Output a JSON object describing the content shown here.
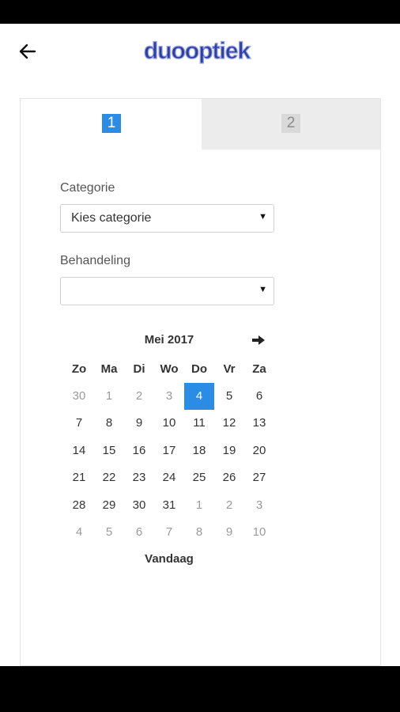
{
  "header": {
    "back_icon": "arrow-left-icon",
    "logo_text": "duooptiek",
    "colors": {
      "logo_fill": "#2f3f9e",
      "accent": "#2b8ce6"
    }
  },
  "steps": [
    {
      "label": "1",
      "active": true
    },
    {
      "label": "2",
      "active": false
    }
  ],
  "form": {
    "category_label": "Categorie",
    "category_value": "Kies categorie",
    "treatment_label": "Behandeling",
    "treatment_value": ""
  },
  "calendar": {
    "month_label": "Mei 2017",
    "next_icon": "arrow-right-icon",
    "weekdays": [
      "Zo",
      "Ma",
      "Di",
      "Wo",
      "Do",
      "Vr",
      "Za"
    ],
    "weeks": [
      [
        {
          "d": "30",
          "m": true
        },
        {
          "d": "1",
          "m": true
        },
        {
          "d": "2",
          "m": true
        },
        {
          "d": "3",
          "m": true
        },
        {
          "d": "4",
          "s": true
        },
        {
          "d": "5"
        },
        {
          "d": "6"
        }
      ],
      [
        {
          "d": "7"
        },
        {
          "d": "8"
        },
        {
          "d": "9"
        },
        {
          "d": "10"
        },
        {
          "d": "11"
        },
        {
          "d": "12"
        },
        {
          "d": "13"
        }
      ],
      [
        {
          "d": "14"
        },
        {
          "d": "15"
        },
        {
          "d": "16"
        },
        {
          "d": "17"
        },
        {
          "d": "18"
        },
        {
          "d": "19"
        },
        {
          "d": "20"
        }
      ],
      [
        {
          "d": "21"
        },
        {
          "d": "22"
        },
        {
          "d": "23"
        },
        {
          "d": "24"
        },
        {
          "d": "25"
        },
        {
          "d": "26"
        },
        {
          "d": "27"
        }
      ],
      [
        {
          "d": "28"
        },
        {
          "d": "29"
        },
        {
          "d": "30"
        },
        {
          "d": "31"
        },
        {
          "d": "1",
          "m": true
        },
        {
          "d": "2",
          "m": true
        },
        {
          "d": "3",
          "m": true
        }
      ],
      [
        {
          "d": "4",
          "m": true
        },
        {
          "d": "5",
          "m": true
        },
        {
          "d": "6",
          "m": true
        },
        {
          "d": "7",
          "m": true
        },
        {
          "d": "8",
          "m": true
        },
        {
          "d": "9",
          "m": true
        },
        {
          "d": "10",
          "m": true
        }
      ]
    ],
    "today_label": "Vandaag"
  }
}
